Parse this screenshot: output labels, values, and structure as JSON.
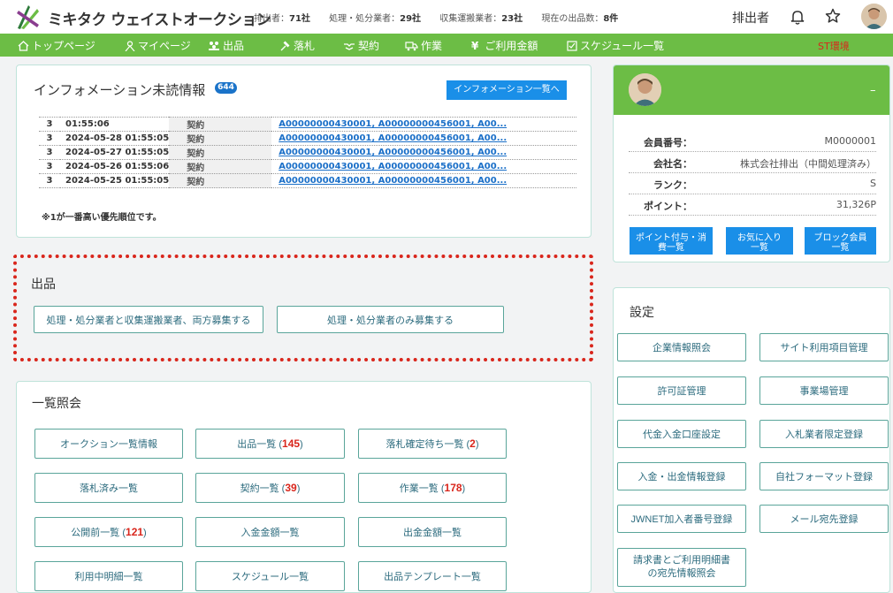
{
  "header": {
    "brand": "ミキタク ウェイストオークション",
    "stats": [
      {
        "label": "排出者：",
        "value": "71社"
      },
      {
        "label": "処理・処分業者：",
        "value": "29社"
      },
      {
        "label": "収集運搬業者：",
        "value": "23社"
      },
      {
        "label": "現在の出品数：",
        "value": "8件"
      }
    ],
    "role": "排出者",
    "icons": {
      "bell": "bell-icon",
      "star": "star-icon",
      "avatar": "avatar"
    }
  },
  "nav": {
    "items": [
      {
        "label": "トップページ",
        "icon": "home-icon"
      },
      {
        "label": "マイページ",
        "icon": "person-icon"
      },
      {
        "label": "出品",
        "icon": "people-group-icon"
      },
      {
        "label": "落札",
        "icon": "gavel-icon"
      },
      {
        "label": "契約",
        "icon": "handshake-icon"
      },
      {
        "label": "作業",
        "icon": "truck-icon"
      },
      {
        "label": "ご利用金額",
        "icon": "yen-icon"
      },
      {
        "label": "スケジュール一覧",
        "icon": "check-square-icon"
      }
    ],
    "env": "ST環境"
  },
  "info": {
    "title": "インフォメーション未読情報",
    "badge": "644",
    "button": "インフォメーション一覧へ",
    "rows": [
      {
        "priority": "3",
        "datetime": "01:55:06",
        "type": "契約",
        "link": "A00000000430001, A00000000456001, A00..."
      },
      {
        "priority": "3",
        "datetime": "2024-05-28 01:55:05",
        "type": "契約",
        "link": "A00000000430001, A00000000456001, A00..."
      },
      {
        "priority": "3",
        "datetime": "2024-05-27 01:55:05",
        "type": "契約",
        "link": "A00000000430001, A00000000456001, A00..."
      },
      {
        "priority": "3",
        "datetime": "2024-05-26 01:55:06",
        "type": "契約",
        "link": "A00000000430001, A00000000456001, A00..."
      },
      {
        "priority": "3",
        "datetime": "2024-05-25 01:55:05",
        "type": "契約",
        "link": "A00000000430001, A00000000456001, A00..."
      }
    ],
    "note": "※1が一番高い優先順位です。"
  },
  "profile": {
    "dash": "–",
    "fields": [
      {
        "key": "会員番号：",
        "value": "M0000001"
      },
      {
        "key": "会社名：",
        "value": "株式会社排出（中間処理済み）"
      },
      {
        "key": "ランク：",
        "value": "S"
      },
      {
        "key": "ポイント：",
        "value": "31,326P"
      }
    ],
    "buttons": [
      {
        "line1": "ポイント付与・消",
        "line2": "費一覧"
      },
      {
        "line1": "お気に入り",
        "line2": "一覧"
      },
      {
        "line1": "ブロック会員",
        "line2": "一覧"
      }
    ]
  },
  "listing": {
    "title": "出品",
    "buttons": [
      "処理・処分業者と収集運搬業者、両方募集する",
      "処理・処分業者のみ募集する"
    ]
  },
  "lookup": {
    "title": "一覧照会",
    "buttons": [
      {
        "label": "オークション一覧情報",
        "count": ""
      },
      {
        "label": "出品一覧 (",
        "count": "145",
        "suffix": ")"
      },
      {
        "label": "落札確定待ち一覧 (",
        "count": "2",
        "suffix": ")"
      },
      {
        "label": "落札済み一覧",
        "count": ""
      },
      {
        "label": "契約一覧 (",
        "count": "39",
        "suffix": ")"
      },
      {
        "label": "作業一覧 (",
        "count": "178",
        "suffix": ")"
      },
      {
        "label": "公開前一覧 (",
        "count": "121",
        "suffix": ")"
      },
      {
        "label": "入金金額一覧",
        "count": ""
      },
      {
        "label": "出金金額一覧",
        "count": ""
      },
      {
        "label": "利用中明細一覧",
        "count": ""
      },
      {
        "label": "スケジュール一覧",
        "count": ""
      },
      {
        "label": "出品テンプレート一覧",
        "count": ""
      }
    ]
  },
  "settings": {
    "title": "設定",
    "buttons": [
      "企業情報照会",
      "サイト利用項目管理",
      "許可証管理",
      "事業場管理",
      "代金入金口座設定",
      "入札業者限定登録",
      "入金・出金情報登録",
      "自社フォーマット登録",
      "JWNET加入者番号登録",
      "メール宛先登録"
    ],
    "last_line1": "請求書とご利用明細書",
    "last_line2": "の宛先情報照会"
  }
}
